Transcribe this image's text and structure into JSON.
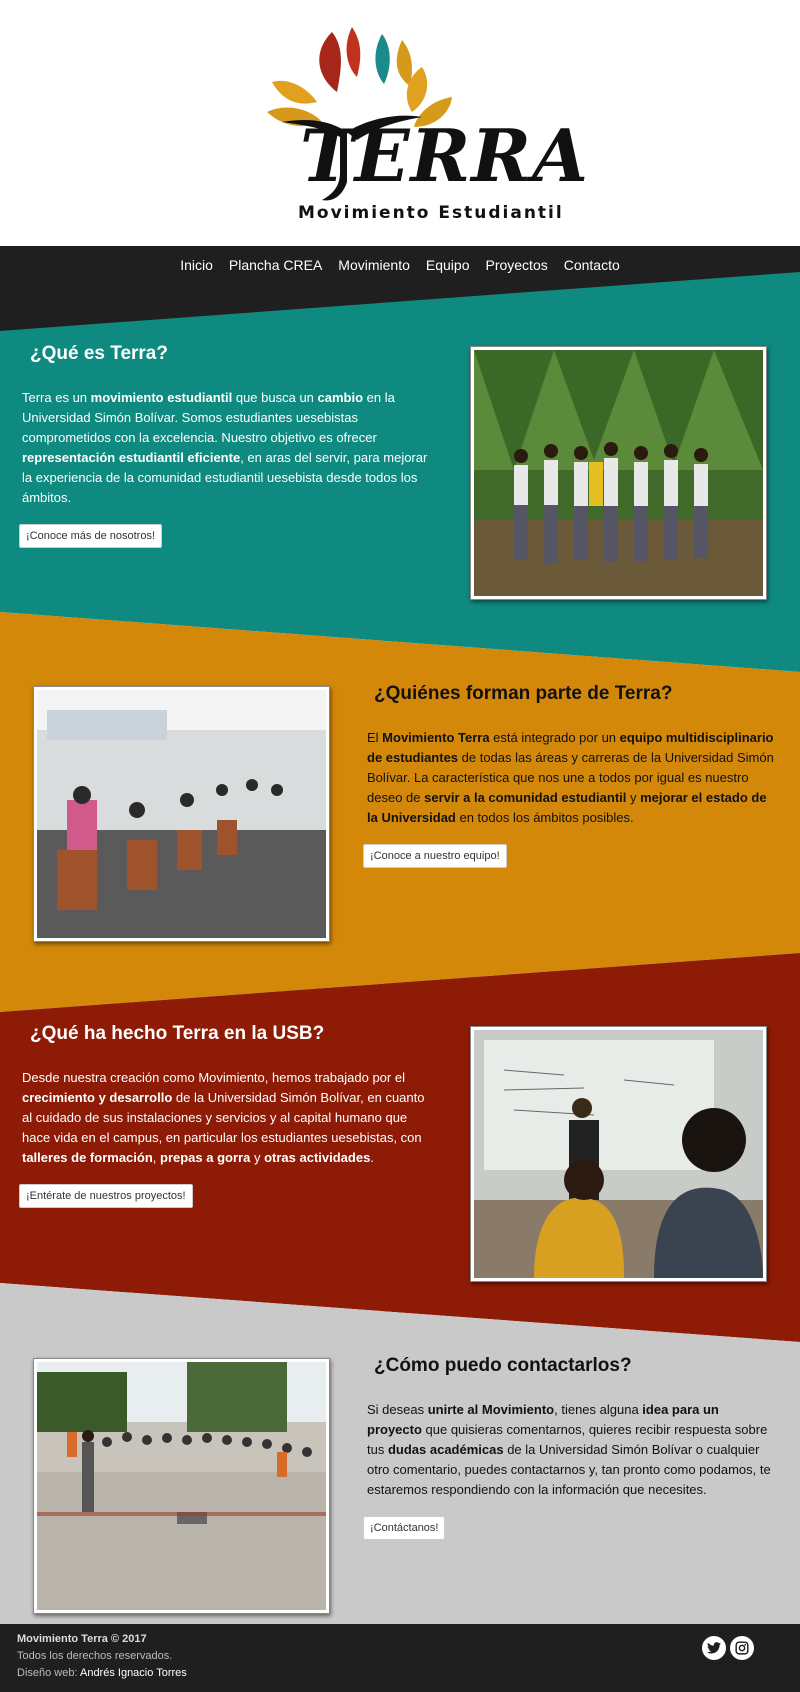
{
  "brand": {
    "name": "TERRA",
    "subtitle": "Movimiento Estudiantil",
    "colors": {
      "teal": "#0f8a80",
      "orange": "#d4880a",
      "red": "#8e1b06",
      "gray": "#c9c9c9",
      "dark": "#1f1f1f"
    }
  },
  "nav": {
    "items": [
      {
        "label": "Inicio"
      },
      {
        "label": "Plancha CREA"
      },
      {
        "label": "Movimiento"
      },
      {
        "label": "Equipo"
      },
      {
        "label": "Proyectos"
      },
      {
        "label": "Contacto"
      }
    ]
  },
  "sections": [
    {
      "title": "¿Qué es Terra?",
      "paragraph": [
        {
          "t": "Terra es un ",
          "b": false
        },
        {
          "t": "movimiento estudiantil",
          "b": true
        },
        {
          "t": " que busca un ",
          "b": false
        },
        {
          "t": "cambio",
          "b": true
        },
        {
          "t": " en la Universidad Simón Bolívar. Somos estudiantes uesebistas comprometidos con la excelencia. Nuestro objetivo es ofrecer ",
          "b": false
        },
        {
          "t": "representación estudiantil eficiente",
          "b": true
        },
        {
          "t": ", en aras del servir, para mejorar la experiencia de la comunidad estudiantil uesebista desde todos los ámbitos.",
          "b": false
        }
      ],
      "button": "¡Conoce más de nosotros!",
      "photo": "group-photo-outdoors"
    },
    {
      "title": "¿Quiénes forman parte de Terra?",
      "paragraph": [
        {
          "t": "El ",
          "b": false
        },
        {
          "t": "Movimiento Terra",
          "b": true
        },
        {
          "t": " está integrado por un ",
          "b": false
        },
        {
          "t": "equipo multidisciplinario de estudiantes",
          "b": true
        },
        {
          "t": " de todas las áreas y carreras de la Universidad Simón Bolívar. La característica que nos une a todos por igual es nuestro deseo de ",
          "b": false
        },
        {
          "t": "servir a la comunidad estudiantil",
          "b": true
        },
        {
          "t": " y ",
          "b": false
        },
        {
          "t": "mejorar el estado de la Universidad",
          "b": true
        },
        {
          "t": " en todos los ámbitos posibles.",
          "b": false
        }
      ],
      "button": "¡Conoce a nuestro equipo!",
      "photo": "classroom-meeting-photo"
    },
    {
      "title": "¿Qué ha hecho Terra en la USB?",
      "paragraph": [
        {
          "t": "Desde nuestra creación como Movimiento, hemos trabajado por el ",
          "b": false
        },
        {
          "t": "crecimiento y desarrollo",
          "b": true
        },
        {
          "t": " de la Universidad Simón Bolívar, en cuanto al cuidado de sus instalaciones y servicios y al capital humano que hace vida en el campus, en particular los estudiantes uesebistas, con ",
          "b": false
        },
        {
          "t": "talleres de formación",
          "b": true
        },
        {
          "t": ", ",
          "b": false
        },
        {
          "t": "prepas a gorra",
          "b": true
        },
        {
          "t": " y ",
          "b": false
        },
        {
          "t": "otras actividades",
          "b": true
        },
        {
          "t": ".",
          "b": false
        }
      ],
      "button": "¡Entérate de nuestros proyectos!",
      "photo": "whiteboard-class-photo"
    },
    {
      "title": "¿Cómo puedo contactarlos?",
      "paragraph": [
        {
          "t": "Si deseas ",
          "b": false
        },
        {
          "t": "unirte al Movimiento",
          "b": true
        },
        {
          "t": ", tienes alguna ",
          "b": false
        },
        {
          "t": "idea para un proyecto",
          "b": true
        },
        {
          "t": " que quisieras comentarnos, quieres recibir respuesta sobre tus ",
          "b": false
        },
        {
          "t": "dudas académicas",
          "b": true
        },
        {
          "t": " de la Universidad Simón Bolívar o cualquier otro comentario, puedes contactarnos y, tan pronto como podamos, te estaremos respondiendo con la información que necesites.",
          "b": false
        }
      ],
      "button": "¡Contáctanos!",
      "photo": "outdoor-assembly-photo"
    }
  ],
  "footer": {
    "copyright": "Movimiento Terra © 2017",
    "rights": "Todos los derechos reservados.",
    "design_label": "Diseño web: ",
    "design_author": "Andrés Ignacio Torres",
    "social": [
      {
        "icon": "twitter-icon"
      },
      {
        "icon": "instagram-icon"
      }
    ]
  }
}
